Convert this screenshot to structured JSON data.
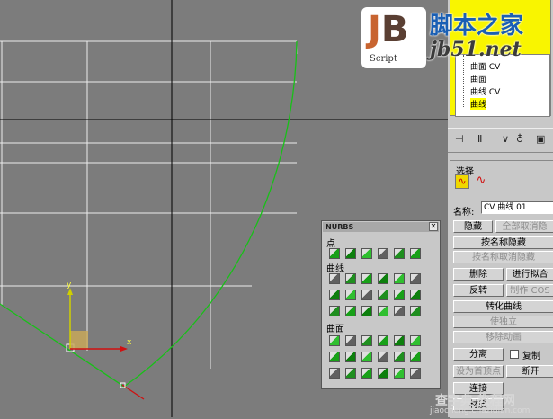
{
  "logo": {
    "text": "JB",
    "sub": "Script",
    "site_cn": "脚本之家",
    "site_url": "jb51.net"
  },
  "tree": {
    "items": [
      "曲面 CV",
      "曲面",
      "曲线 CV",
      "曲线"
    ],
    "selected": "曲线"
  },
  "panel": {
    "section_select": "选择",
    "name_label": "名称:",
    "name_value": "CV 曲线 01",
    "hide": "隐藏",
    "unhide_all": "全部取消隐",
    "hide_by_name": "按名称隐藏",
    "unhide_by_name": "按名称取消隐藏",
    "delete": "删除",
    "fuse": "进行拟合",
    "reverse": "反转",
    "make_cos": "制作 COS",
    "convert_curve": "转化曲线",
    "make_independent": "使独立",
    "remove_animation": "移除动画",
    "detach": "分离",
    "copy": "复制",
    "set_first_vertex": "设为首顶点",
    "break": "断开",
    "connect": "连接",
    "material": "材质"
  },
  "nurbs": {
    "title": "NURBS",
    "close": "✕",
    "sec_point": "点",
    "sec_curve": "曲线",
    "sec_surface": "曲面"
  },
  "gizmo": {
    "y": "y",
    "x": "x"
  },
  "watermark": {
    "line1": "查字典 教程网",
    "line2": "jiaocheng.chazidian.com"
  },
  "colors": {
    "curve": "#18c018",
    "grid": "#e8e8e8",
    "axis": "#000000",
    "highlight": "#ffff00"
  }
}
